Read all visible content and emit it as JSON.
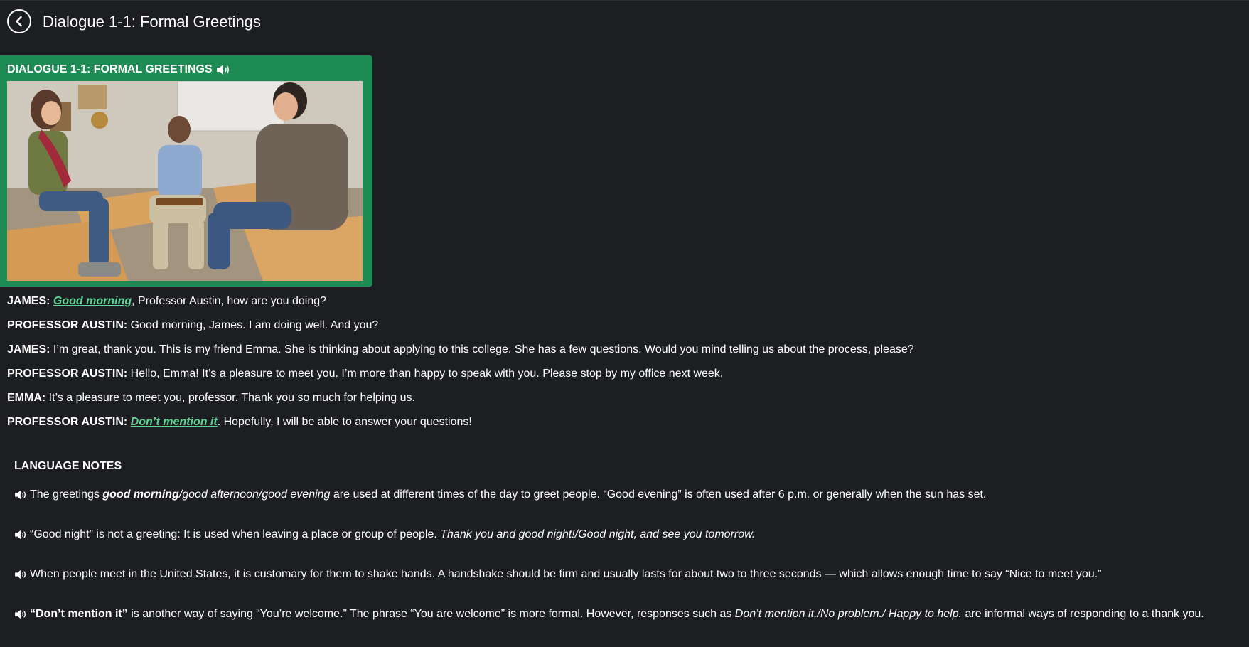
{
  "header": {
    "title": "Dialogue 1-1: Formal Greetings",
    "back_icon": "chevron-left-icon"
  },
  "card": {
    "title": "DIALOGUE 1-1: FORMAL GREETINGS",
    "audio_icon": "speaker-icon",
    "accent_color": "#1e8a54"
  },
  "dialogue": [
    {
      "speaker": "JAMES:",
      "link": "Good morning",
      "text": ", Professor Austin, how are you doing?"
    },
    {
      "speaker": "PROFESSOR AUSTIN:",
      "text": "Good morning, James. I am doing well. And you?"
    },
    {
      "speaker": "JAMES:",
      "text": "I’m great, thank you. This is my friend Emma. She is thinking about applying to this college. She has a few questions. Would you mind telling us about the process, please?"
    },
    {
      "speaker": "PROFESSOR AUSTIN:",
      "text": "Hello, Emma! It’s a pleasure to meet you. I’m more than happy to speak with you. Please stop by my office next week."
    },
    {
      "speaker": "EMMA:",
      "text": "It’s a pleasure to meet you, professor. Thank you so much for helping us."
    },
    {
      "speaker": "PROFESSOR AUSTIN:",
      "link": "Don’t mention it",
      "text": ". Hopefully, I will be able to answer your questions!"
    }
  ],
  "notes": {
    "title": "LANGUAGE NOTES",
    "items": [
      {
        "a": "The greetings ",
        "b_bold_italic": "good morning",
        "c_italic": "/good afternoon/good evening",
        "d": " are used at different times of the day to greet people. “Good evening” is often used after 6 p.m. or generally when the sun has set."
      },
      {
        "a": "“Good night” is not a greeting: It is used when leaving a place or group of people. ",
        "c_italic": "Thank you and good night!/Good night, and see you tomorrow."
      },
      {
        "a": "When people meet in the United States, it is customary for them to shake hands. A handshake should be firm and usually lasts for about two to three seconds — which allows enough time to say “Nice to meet you.”"
      },
      {
        "b_bold": "“Don’t mention it”",
        "a": " is another way of saying “You’re welcome.” The phrase “You are welcome” is more formal. However, responses such as ",
        "c_italic": "Don’t mention it./No problem./ Happy to help.",
        "d": " are informal ways of responding to a thank you."
      }
    ]
  }
}
